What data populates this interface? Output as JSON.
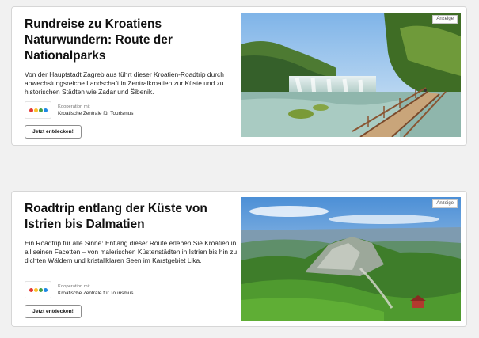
{
  "cards": [
    {
      "title": "Rundreise zu Kroatiens Naturwundern: Route der Nationalparks",
      "description": "Von der Hauptstadt Zagreb aus führt dieser Kroatien-Roadtrip durch abwechslungsreiche Landschaft in Zentralkroatien zur Küste und zu historischen Städten wie Zadar und Šibenik.",
      "cooperation_label": "Kooperation mit",
      "partner_name": "Kroatische Zentrale für Tourismus",
      "button_label": "Jetzt entdecken!",
      "ad_badge": "Anzeige",
      "image": "waterfall-with-boardwalk-photo"
    },
    {
      "title": "Roadtrip entlang der Küste von Istrien bis Dalmatien",
      "description": "Ein Roadtrip für alle Sinne: Entlang dieser Route erleben Sie Kroatien in all seinen Facetten – von malerischen Küstenstädten in Istrien bis hin zu dichten Wäldern und kristallklaren Seen im Karstgebiet Lika.",
      "cooperation_label": "Kooperation mit",
      "partner_name": "Kroatische Zentrale für Tourismus",
      "button_label": "Jetzt entdecken!",
      "ad_badge": "Anzeige",
      "image": "green-mountain-landscape-photo"
    }
  ]
}
